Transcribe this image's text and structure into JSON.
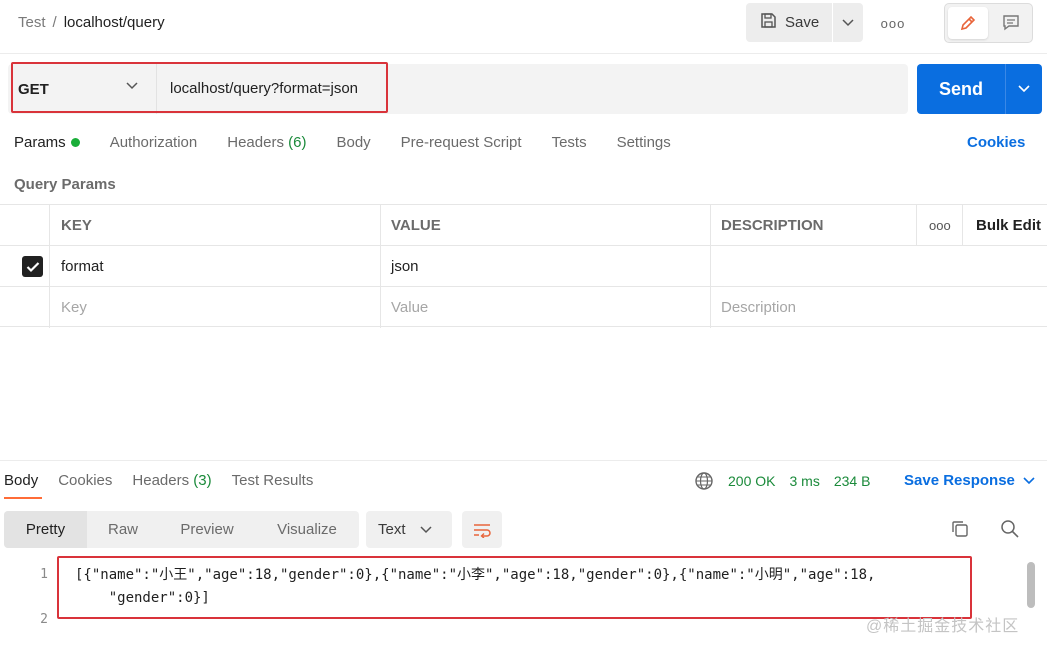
{
  "breadcrumb": {
    "parent": "Test",
    "separator": "/",
    "current": "localhost/query"
  },
  "header": {
    "save_label": "Save",
    "more_label": "ooo"
  },
  "request": {
    "method": "GET",
    "url": "localhost/query?format=json",
    "send_label": "Send"
  },
  "req_tabs": {
    "params": "Params",
    "authorization": "Authorization",
    "headers": "Headers",
    "headers_count": "(6)",
    "body": "Body",
    "prerequest": "Pre-request Script",
    "tests": "Tests",
    "settings": "Settings",
    "cookies": "Cookies"
  },
  "query_params": {
    "label": "Query Params",
    "columns": {
      "key": "KEY",
      "value": "VALUE",
      "description": "DESCRIPTION",
      "more": "ooo",
      "bulk_edit": "Bulk Edit"
    },
    "rows": [
      {
        "checked": true,
        "key": "format",
        "value": "json",
        "description": ""
      }
    ],
    "placeholders": {
      "key": "Key",
      "value": "Value",
      "description": "Description"
    }
  },
  "response": {
    "tabs": {
      "body": "Body",
      "cookies": "Cookies",
      "headers": "Headers",
      "headers_count": "(3)",
      "tests": "Test Results"
    },
    "status": "200 OK",
    "time": "3 ms",
    "size": "234 B",
    "save_response": "Save Response",
    "views": {
      "pretty": "Pretty",
      "raw": "Raw",
      "preview": "Preview",
      "visualize": "Visualize"
    },
    "format": "Text",
    "line_numbers": [
      "1",
      "2"
    ],
    "code_line1": "[{\"name\":\"小王\",\"age\":18,\"gender\":0},{\"name\":\"小李\",\"age\":18,\"gender\":0},{\"name\":\"小明\",\"age\":18,",
    "code_line1b": "    \"gender\":0}]"
  },
  "watermark": "@稀土掘金技术社区",
  "colors": {
    "accent": "#0a6ee0",
    "highlight": "#d9333a",
    "tab_indicator": "#ff6c37",
    "success": "#1a8a3a"
  }
}
